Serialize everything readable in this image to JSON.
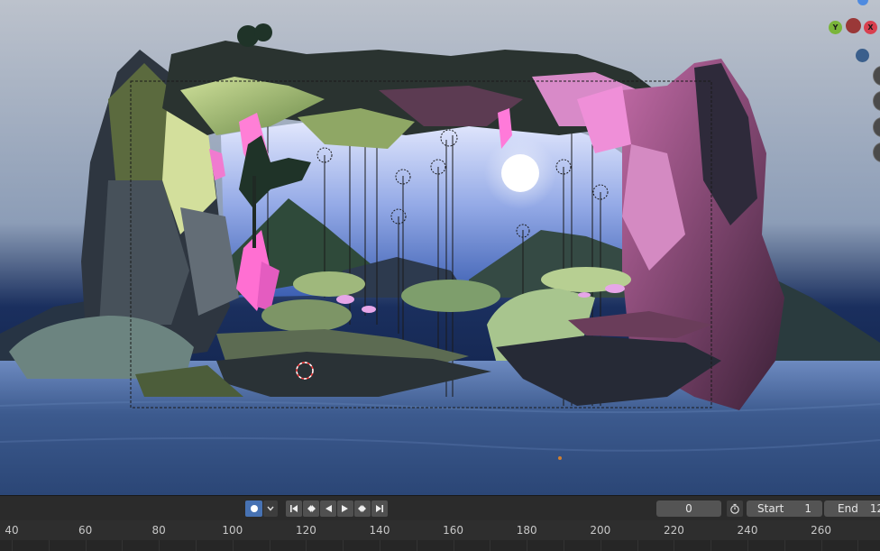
{
  "viewport": {
    "gizmo": {
      "y_label": "Y",
      "x_label": "X"
    },
    "colors": {
      "sky_top": "#b9c0cc",
      "sky_bottom": "#4c6ea8",
      "water": "#3b5786",
      "rock_dark": "#2e3a2f",
      "rock_moss": "#b4c87a",
      "crystal_pink": "#ff7ad9",
      "rock_magenta": "#9a4a7a",
      "moon": "#ffffff"
    }
  },
  "timeline": {
    "current_frame": "0",
    "start_label": "Start",
    "start_value": "1",
    "end_label": "End",
    "end_value": "12",
    "ruler_ticks": [
      "40",
      "60",
      "80",
      "100",
      "120",
      "140",
      "160",
      "180",
      "200",
      "220",
      "240",
      "260"
    ]
  }
}
